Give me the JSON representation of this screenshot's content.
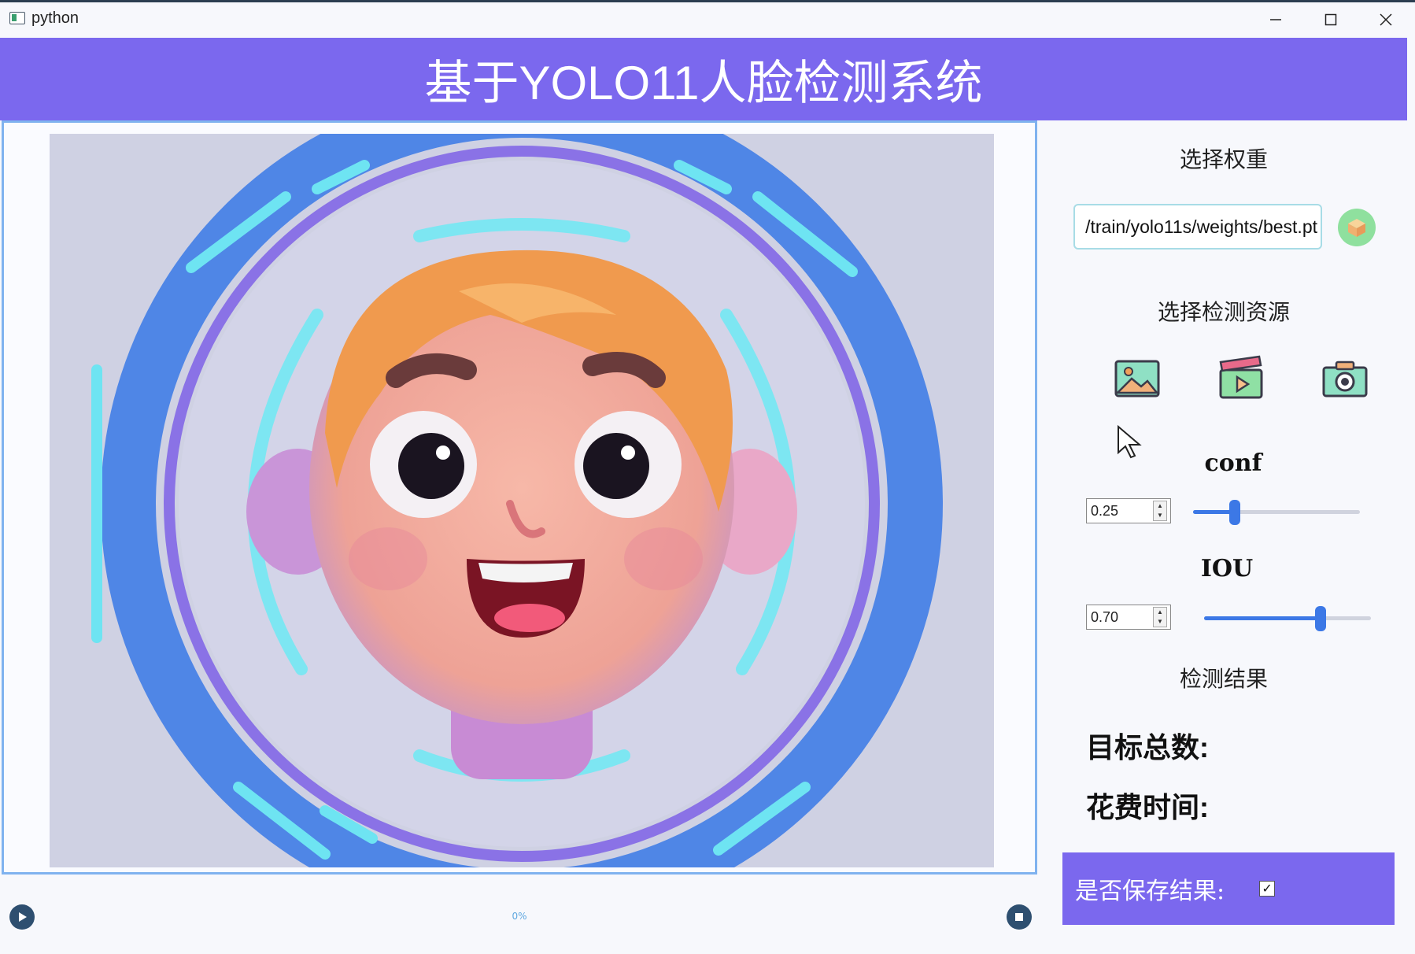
{
  "window": {
    "title": "python",
    "minimize_icon": "minimize-icon",
    "maximize_icon": "maximize-icon",
    "close_icon": "close-icon"
  },
  "header": {
    "title": "基于YOLO11人脸检测系统",
    "background": "#7b68ee"
  },
  "preview": {
    "image_icon": "cartoon-face-illustration"
  },
  "playback": {
    "progress_text": "0%",
    "play_icon": "play-icon",
    "stop_icon": "stop-icon"
  },
  "weights": {
    "title": "选择权重",
    "path_value": "/train/yolo11s/weights/best.pt",
    "browse_icon": "cube-icon"
  },
  "source": {
    "title": "选择检测资源",
    "image_icon": "image-icon",
    "video_icon": "video-clapper-icon",
    "camera_icon": "camera-icon"
  },
  "conf": {
    "label": "conf",
    "value": "0.25",
    "slider_fraction": 0.25
  },
  "iou": {
    "label": "IOU",
    "value": "0.70",
    "slider_fraction": 0.7
  },
  "results": {
    "title": "检测结果",
    "total_label": "目标总数:",
    "time_label": "花费时间:"
  },
  "save": {
    "label": "是否保存结果:",
    "checked": true,
    "background": "#7b68ee"
  },
  "colors": {
    "accent": "#7b68ee",
    "slider": "#3c78e6",
    "panel_border": "#7fb2ef"
  }
}
